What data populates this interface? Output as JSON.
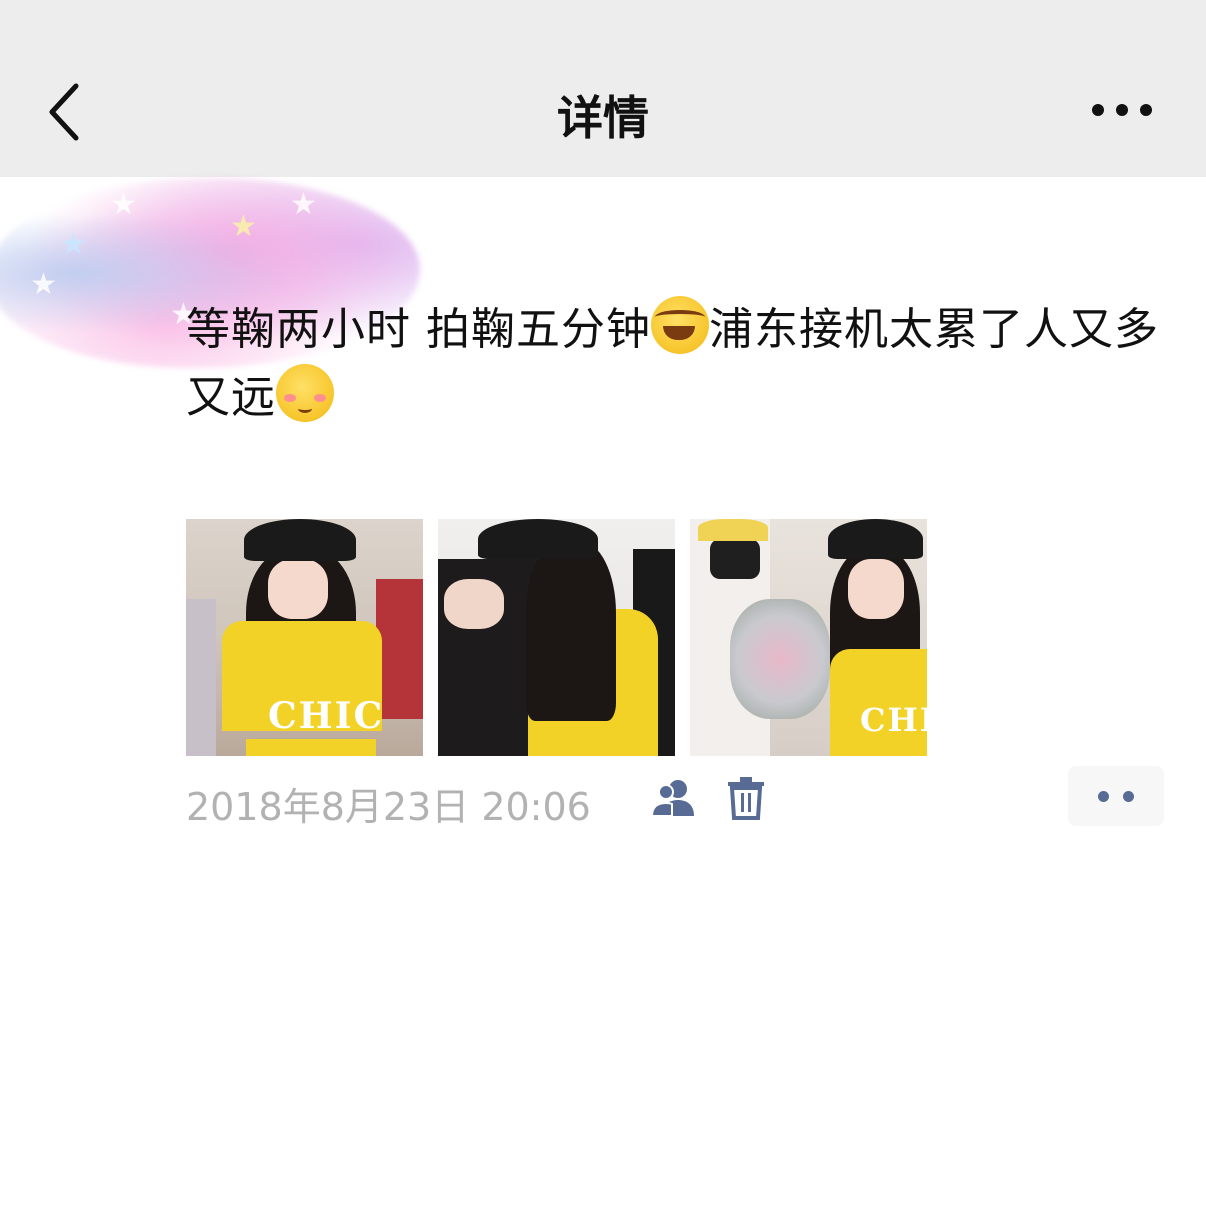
{
  "navbar": {
    "title": "详情",
    "back_icon": "chevron-left-icon",
    "more_icon": "more-horizontal-icon"
  },
  "post": {
    "author_area": "blurred",
    "text_part1": "等鞠两小时 拍鞠五分钟",
    "emoji1": "rolling-on-floor-laughing-emoji",
    "text_part2": "浦东接机太累了人又多又远",
    "emoji2": "blushing-emoji",
    "photos": [
      {
        "alt": "photo-1",
        "shirt_text": "CHIC"
      },
      {
        "alt": "photo-2",
        "shirt_text": ""
      },
      {
        "alt": "photo-3",
        "shirt_text": "CHI"
      }
    ]
  },
  "meta": {
    "timestamp": "2018年8月23日 20:06",
    "privacy_icon": "people-icon",
    "delete_icon": "trash-icon",
    "comment_icon": "more-dots-icon"
  },
  "colors": {
    "navbar_bg": "#ededed",
    "link_blue": "#576b95",
    "timestamp_gray": "#b2b2b2",
    "shirt_yellow": "#f2d226"
  }
}
